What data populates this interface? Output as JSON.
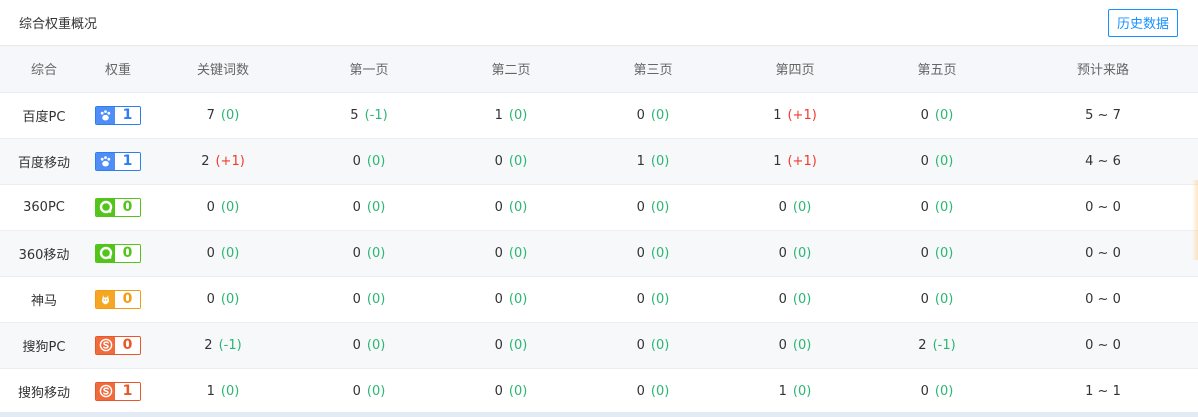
{
  "header": {
    "title": "综合权重概况",
    "history_button": "历史数据"
  },
  "columns": [
    "综合",
    "权重",
    "关键词数",
    "第一页",
    "第二页",
    "第三页",
    "第四页",
    "第五页",
    "预计来路"
  ],
  "colors": {
    "positive": "#2bb673",
    "negative": "#ef3b2d",
    "button": "#1890ff"
  },
  "badge_styles": {
    "baidu": {
      "border": "#2e7df3",
      "fill": "#4e8ef6",
      "text": "#2e7df3",
      "icon": "paw-icon"
    },
    "so360": {
      "border": "#52c41a",
      "fill": "#52c41a",
      "text": "#52c41a",
      "icon": "ring-icon"
    },
    "shenma": {
      "border": "#f39c12",
      "fill": "#f5a623",
      "text": "#f39c12",
      "icon": "horse-icon"
    },
    "sogou": {
      "border": "#e8562a",
      "fill": "#ef6b3c",
      "text": "#e8562a",
      "icon": "s-logo-icon"
    }
  },
  "rows": [
    {
      "name": "百度PC",
      "engine": "baidu",
      "weight": "1",
      "cells": [
        {
          "value": "7",
          "delta": "(0)",
          "trend": "zero"
        },
        {
          "value": "5",
          "delta": "(-1)",
          "trend": "down"
        },
        {
          "value": "1",
          "delta": "(0)",
          "trend": "zero"
        },
        {
          "value": "0",
          "delta": "(0)",
          "trend": "zero"
        },
        {
          "value": "1",
          "delta": "(+1)",
          "trend": "up"
        },
        {
          "value": "0",
          "delta": "(0)",
          "trend": "zero"
        }
      ],
      "traffic": "5 ~ 7"
    },
    {
      "name": "百度移动",
      "engine": "baidu",
      "weight": "1",
      "cells": [
        {
          "value": "2",
          "delta": "(+1)",
          "trend": "up"
        },
        {
          "value": "0",
          "delta": "(0)",
          "trend": "zero"
        },
        {
          "value": "0",
          "delta": "(0)",
          "trend": "zero"
        },
        {
          "value": "1",
          "delta": "(0)",
          "trend": "zero"
        },
        {
          "value": "1",
          "delta": "(+1)",
          "trend": "up"
        },
        {
          "value": "0",
          "delta": "(0)",
          "trend": "zero"
        }
      ],
      "traffic": "4 ~ 6"
    },
    {
      "name": "360PC",
      "engine": "so360",
      "weight": "0",
      "cells": [
        {
          "value": "0",
          "delta": "(0)",
          "trend": "zero"
        },
        {
          "value": "0",
          "delta": "(0)",
          "trend": "zero"
        },
        {
          "value": "0",
          "delta": "(0)",
          "trend": "zero"
        },
        {
          "value": "0",
          "delta": "(0)",
          "trend": "zero"
        },
        {
          "value": "0",
          "delta": "(0)",
          "trend": "zero"
        },
        {
          "value": "0",
          "delta": "(0)",
          "trend": "zero"
        }
      ],
      "traffic": "0 ~ 0"
    },
    {
      "name": "360移动",
      "engine": "so360",
      "weight": "0",
      "cells": [
        {
          "value": "0",
          "delta": "(0)",
          "trend": "zero"
        },
        {
          "value": "0",
          "delta": "(0)",
          "trend": "zero"
        },
        {
          "value": "0",
          "delta": "(0)",
          "trend": "zero"
        },
        {
          "value": "0",
          "delta": "(0)",
          "trend": "zero"
        },
        {
          "value": "0",
          "delta": "(0)",
          "trend": "zero"
        },
        {
          "value": "0",
          "delta": "(0)",
          "trend": "zero"
        }
      ],
      "traffic": "0 ~ 0"
    },
    {
      "name": "神马",
      "engine": "shenma",
      "weight": "0",
      "cells": [
        {
          "value": "0",
          "delta": "(0)",
          "trend": "zero"
        },
        {
          "value": "0",
          "delta": "(0)",
          "trend": "zero"
        },
        {
          "value": "0",
          "delta": "(0)",
          "trend": "zero"
        },
        {
          "value": "0",
          "delta": "(0)",
          "trend": "zero"
        },
        {
          "value": "0",
          "delta": "(0)",
          "trend": "zero"
        },
        {
          "value": "0",
          "delta": "(0)",
          "trend": "zero"
        }
      ],
      "traffic": "0 ~ 0"
    },
    {
      "name": "搜狗PC",
      "engine": "sogou",
      "weight": "0",
      "cells": [
        {
          "value": "2",
          "delta": "(-1)",
          "trend": "down"
        },
        {
          "value": "0",
          "delta": "(0)",
          "trend": "zero"
        },
        {
          "value": "0",
          "delta": "(0)",
          "trend": "zero"
        },
        {
          "value": "0",
          "delta": "(0)",
          "trend": "zero"
        },
        {
          "value": "0",
          "delta": "(0)",
          "trend": "zero"
        },
        {
          "value": "2",
          "delta": "(-1)",
          "trend": "down"
        }
      ],
      "traffic": "0 ~ 0"
    },
    {
      "name": "搜狗移动",
      "engine": "sogou",
      "weight": "1",
      "cells": [
        {
          "value": "1",
          "delta": "(0)",
          "trend": "zero"
        },
        {
          "value": "0",
          "delta": "(0)",
          "trend": "zero"
        },
        {
          "value": "0",
          "delta": "(0)",
          "trend": "zero"
        },
        {
          "value": "0",
          "delta": "(0)",
          "trend": "zero"
        },
        {
          "value": "1",
          "delta": "(0)",
          "trend": "zero"
        },
        {
          "value": "0",
          "delta": "(0)",
          "trend": "zero"
        }
      ],
      "traffic": "1 ~ 1"
    }
  ]
}
